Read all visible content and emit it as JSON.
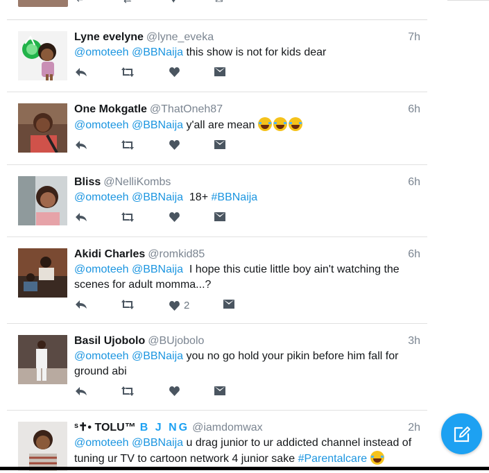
{
  "colors": {
    "accent": "#1da1f2",
    "mention": "#1b95e0",
    "text": "#14171a",
    "muted": "#7b8591"
  },
  "tweets": [
    {
      "name": "Lyne evelyne",
      "handle": "@lyne_eveka",
      "time": "7h",
      "mention1": "@omoteeh",
      "mention2": "@BBNaija",
      "text": "this show is not for kids dear",
      "like_count": ""
    },
    {
      "name": "One Mokgatle",
      "handle": "@ThatOneh87",
      "time": "6h",
      "mention1": "@omoteeh",
      "mention2": "@BBNaija",
      "text": "y'all are mean",
      "emoji": "joy-emoji x3",
      "like_count": ""
    },
    {
      "name": "Bliss",
      "handle": "@NelliKombs",
      "time": "6h",
      "mention1": "@omoteeh",
      "mention2": "@BBNaija",
      "text": "18+",
      "hashtag": "#BBNaija",
      "like_count": ""
    },
    {
      "name": "Akidi Charles",
      "handle": "@romkid85",
      "time": "6h",
      "mention1": "@omoteeh",
      "mention2": "@BBNaija",
      "text": "I hope this cutie little boy ain't watching the scenes for adult momma...?",
      "like_count": "2"
    },
    {
      "name": "Basil Ujobolo",
      "handle": "@BUjobolo",
      "time": "3h",
      "mention1": "@omoteeh",
      "mention2": "@BBNaija",
      "text": "you no go hold your pikin before him fall for ground abi",
      "like_count": ""
    },
    {
      "name": "ˢ✝• TOLU™",
      "name_styled": "B J NG",
      "handle": "@iamdomwax",
      "time": "2h",
      "mention1": "@omoteeh",
      "mention2": "@BBNaija",
      "text": "u drag junior to ur addicted channel instead of tuning ur TV to cartoon network 4 junior sake",
      "hashtag": "#Parentalcare",
      "like_count": ""
    }
  ],
  "icons": {
    "reply": "reply-icon",
    "retweet": "retweet-icon",
    "like": "heart-icon",
    "dm": "envelope-icon",
    "compose": "compose-icon"
  }
}
